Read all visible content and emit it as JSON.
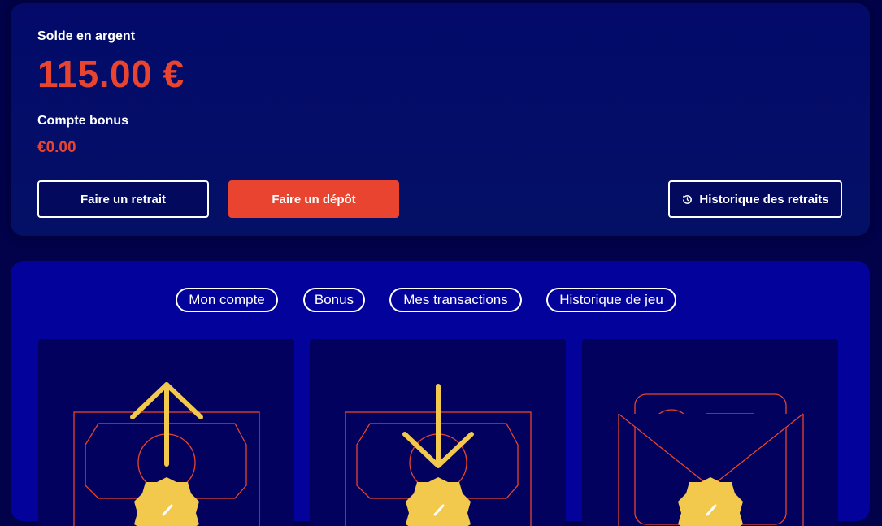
{
  "balance": {
    "cash_label": "Solde en argent",
    "cash_amount": "115.00 €",
    "bonus_label": "Compte bonus",
    "bonus_amount": "€0.00"
  },
  "actions": {
    "withdraw_label": "Faire un retrait",
    "deposit_label": "Faire un dépôt",
    "history_label": "Historique des retraits",
    "history_icon": "history-icon"
  },
  "tabs": [
    {
      "label": "Mon compte"
    },
    {
      "label": "Bonus"
    },
    {
      "label": "Mes transactions"
    },
    {
      "label": "Historique de jeu"
    }
  ],
  "tiles": [
    {
      "icon": "withdraw-illustration-icon"
    },
    {
      "icon": "deposit-illustration-icon"
    },
    {
      "icon": "verification-envelope-icon"
    }
  ],
  "colors": {
    "accent": "#e8442f",
    "gold": "#f2c94c",
    "background": "#01024a",
    "card": "#041066",
    "panel": "#03029a",
    "tile": "#02025e"
  }
}
